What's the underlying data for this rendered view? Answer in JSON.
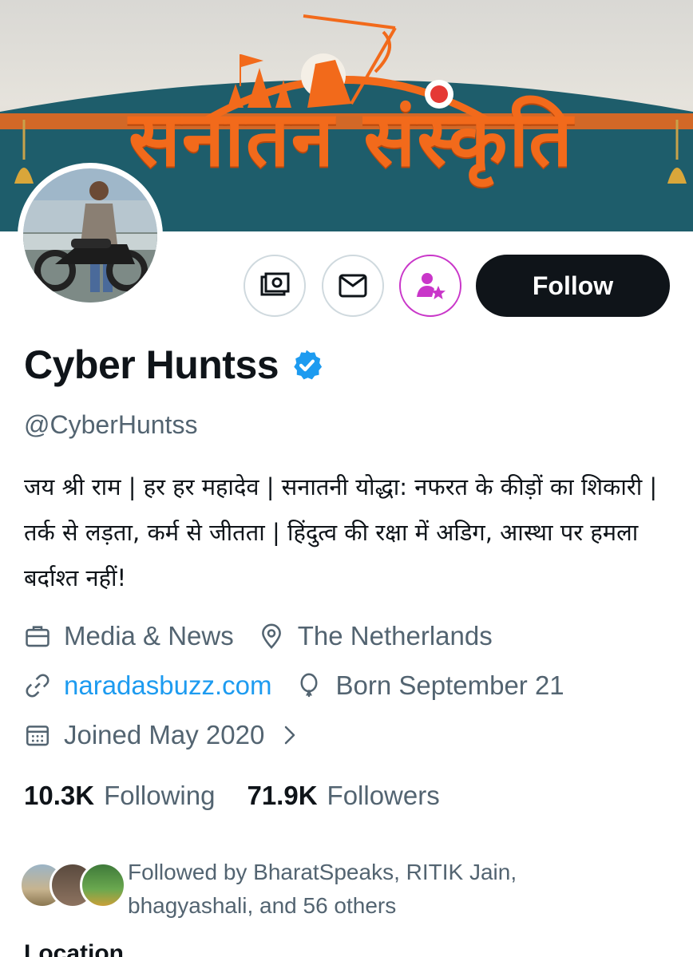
{
  "banner": {
    "title": "सनातन संस्कृति"
  },
  "actions": {
    "follow_label": "Follow"
  },
  "profile": {
    "name": "Cyber Huntss",
    "handle": "@CyberHuntss",
    "bio": "जय श्री राम | हर हर महादेव | सनातनी योद्धा: नफरत के कीड़ों का शिकारी | तर्क से लड़ता, कर्म से जीतता | हिंदुत्व की रक्षा में अडिग, आस्था पर हमला बर्दाश्त नहीं!",
    "category": "Media & News",
    "location": "The Netherlands",
    "website": "naradasbuzz.com",
    "birthday": "Born September 21",
    "joined": "Joined May 2020"
  },
  "stats": {
    "following_count": "10.3K",
    "following_label": "Following",
    "followers_count": "71.9K",
    "followers_label": "Followers"
  },
  "followed_by": {
    "text": "Followed by BharatSpeaks, RITIK Jain, bhagyashali, and 56 others"
  },
  "sections": {
    "location_heading": "Location"
  },
  "colors": {
    "accent": "#1d9bf0",
    "subscribe": "#c936c9",
    "banner_orange": "#f26a1b",
    "banner_teal": "#1e5d6b"
  }
}
